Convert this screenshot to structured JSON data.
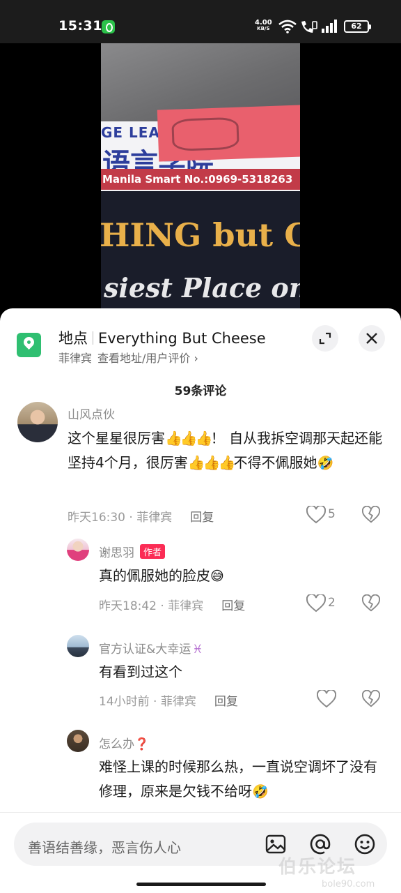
{
  "status_bar": {
    "time": "15:31",
    "net_speed": "4.00",
    "net_unit": "KB/S",
    "battery": "62"
  },
  "video": {
    "sign_line1": "GE LEARN",
    "sign_line2": "语言学院",
    "sign_line3": "Manila  Smart No.:0969-5318263",
    "sign_gold": "HING but C",
    "sign_gold_italic": "but",
    "sign_script": "siest Place on E"
  },
  "location": {
    "label": "地点",
    "name": "Everything But Cheese",
    "country": "菲律宾",
    "details_link": "查看地址/用户评价",
    "chevron": "›"
  },
  "comments_header": {
    "count_label": "59条评论"
  },
  "comments": [
    {
      "user": "山风点伙",
      "text_a": "这个星星很厉害",
      "emoji_a": "👍👍👍",
      "text_b": "！ 自从我拆空调那天起还能坚持4个月，很厉害",
      "emoji_b": "👍👍👍",
      "text_c": "不得不佩服她",
      "emoji_c": "🤣",
      "time_loc": "昨天16:30 · 菲律宾",
      "reply_label": "回复",
      "likes": "5"
    },
    {
      "user": "谢思羽",
      "badge": "作者",
      "text_a": "真的佩服她的脸皮",
      "emoji_a": "😅",
      "time_loc": "昨天18:42 · 菲律宾",
      "reply_label": "回复",
      "likes": "2"
    },
    {
      "user": "官方认证&大幸运",
      "user_emoji": "♓",
      "text_a": "有看到过这个",
      "time_loc": "14小时前 · 菲律宾",
      "reply_label": "回复"
    },
    {
      "user": "怎么办",
      "user_emoji": "❓",
      "text_a": "难怪上课的时候那么热，一直说空调坏了没有修理，原来是欠钱不给呀",
      "emoji_a": "🤣"
    }
  ],
  "input": {
    "placeholder": "善语结善缘，恶言伤人心"
  },
  "watermark": {
    "brand": "伯乐论坛",
    "url": "bole90.com"
  },
  "colors": {
    "accent_red": "#fb2c55",
    "pin_green": "#2fbf71",
    "status_green": "#2bc24a"
  },
  "icons": [
    "wifi-icon",
    "call-icon",
    "signal-icon",
    "location-pin-icon",
    "expand-icon",
    "close-icon",
    "heart-icon",
    "broken-heart-icon",
    "image-icon",
    "at-icon",
    "emoji-icon"
  ]
}
